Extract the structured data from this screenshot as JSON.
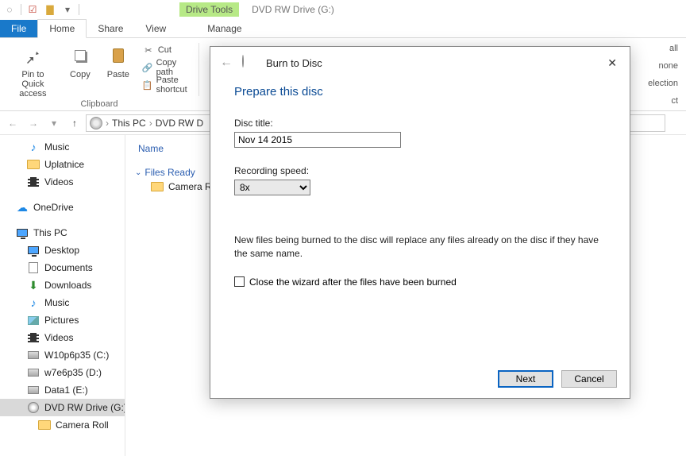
{
  "titlebar": {
    "drive_tools": "Drive Tools",
    "drive_label": "DVD RW Drive (G:)"
  },
  "tabs": {
    "file": "File",
    "home": "Home",
    "share": "Share",
    "view": "View",
    "manage": "Manage"
  },
  "ribbon": {
    "pin": "Pin to Quick access",
    "copy": "Copy",
    "paste": "Paste",
    "cut": "Cut",
    "copy_path": "Copy path",
    "paste_shortcut": "Paste shortcut",
    "clipboard_group": "Clipboard",
    "right_items": [
      "all",
      "none",
      "election",
      "ct"
    ]
  },
  "breadcrumb": {
    "root": "This PC",
    "drive": "DVD RW D"
  },
  "content": {
    "col_name": "Name",
    "group": "Files Ready",
    "file1": "Camera Rol"
  },
  "tree": {
    "music": "Music",
    "uplatnice": "Uplatnice",
    "videos1": "Videos",
    "onedrive": "OneDrive",
    "thispc": "This PC",
    "desktop": "Desktop",
    "documents": "Documents",
    "downloads": "Downloads",
    "music2": "Music",
    "pictures": "Pictures",
    "videos2": "Videos",
    "disk1": "W10p6p35 (C:)",
    "disk2": "w7e6p35 (D:)",
    "disk3": "Data1 (E:)",
    "dvd": "DVD RW Drive (G:)",
    "camera": "Camera Roll"
  },
  "dialog": {
    "title": "Burn to Disc",
    "heading": "Prepare this disc",
    "disc_title_label": "Disc title:",
    "disc_title_value": "Nov 14 2015",
    "rec_speed_label": "Recording speed:",
    "rec_speed_value": "8x",
    "note": "New files being burned to the disc will replace any files already on the disc if they have the same name.",
    "close_wizard": "Close the wizard after the files have been burned",
    "next": "Next",
    "cancel": "Cancel"
  }
}
